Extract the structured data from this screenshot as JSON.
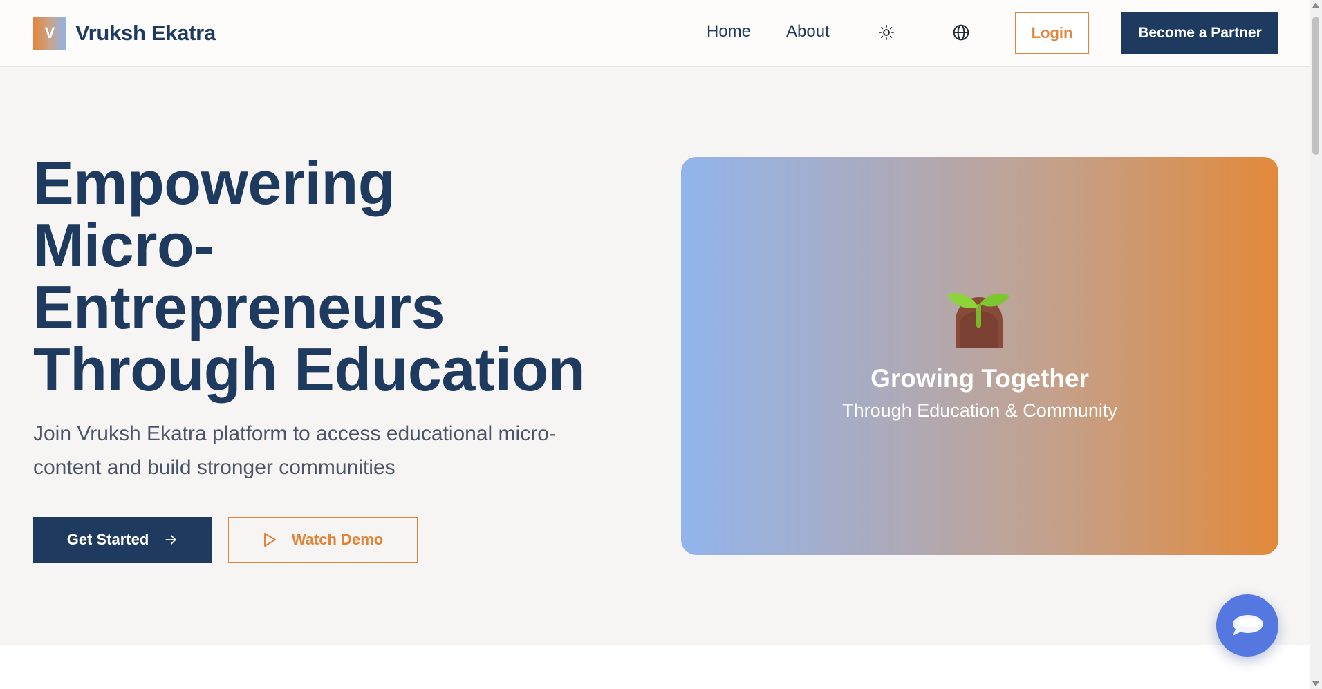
{
  "brand": {
    "logo_letter": "V",
    "name": "Vruksh Ekatra"
  },
  "nav": {
    "home": "Home",
    "about": "About",
    "theme_icon": "sun-icon",
    "language_icon": "globe-icon",
    "login": "Login",
    "partner": "Become a Partner"
  },
  "hero": {
    "title_lines": [
      "Empowering",
      "Micro-",
      "Entrepreneurs",
      "Through Education"
    ],
    "subtitle": "Join Vruksh Ekatra platform to access educational micro-content and build stronger communities",
    "primary_cta": "Get Started",
    "secondary_cta": "Watch Demo"
  },
  "card": {
    "icon": "sprout-icon",
    "title": "Growing Together",
    "subtitle": "Through Education & Community"
  },
  "chat": {
    "icon": "chat-bubble-icon"
  },
  "colors": {
    "navy": "#1f3a5f",
    "orange": "#e2853a",
    "chat_blue": "#5477e0",
    "hero_bg": "#f6f5f4"
  }
}
